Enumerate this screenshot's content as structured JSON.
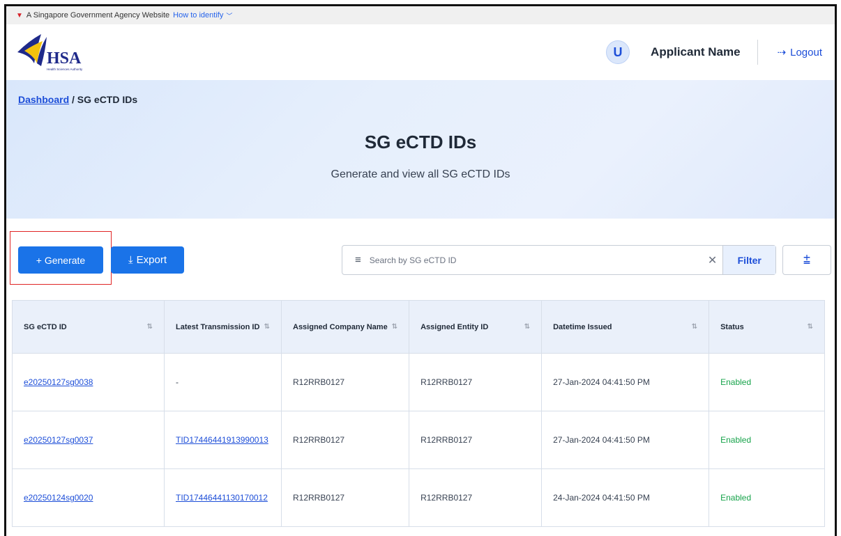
{
  "gov_banner": {
    "text": "A Singapore Government Agency Website",
    "identify_label": "How to identify"
  },
  "header": {
    "logo_text": "HSA",
    "logo_subtext": "Health Sciences Authority",
    "avatar_initial": "U",
    "applicant_name": "Applicant Name",
    "logout_label": "Logout"
  },
  "hero": {
    "breadcrumb_home": "Dashboard",
    "breadcrumb_separator": "/",
    "breadcrumb_current": "SG eCTD IDs",
    "title": "SG eCTD IDs",
    "subtitle": "Generate and view all SG eCTD IDs"
  },
  "toolbar": {
    "generate_label": "+ Generate",
    "export_label": "Export",
    "search_placeholder": "Search by SG eCTD ID",
    "filter_label": "Filter"
  },
  "table": {
    "columns": [
      "SG eCTD ID",
      "Latest Transmission ID",
      "Assigned Company Name",
      "Assigned Entity ID",
      "Datetime Issued",
      "Status"
    ],
    "rows": [
      {
        "id": "e20250127sg0038",
        "transmission": "-",
        "company": "R12RRB0127",
        "entity": "R12RRB0127",
        "datetime": "27-Jan-2024 04:41:50 PM",
        "status": "Enabled"
      },
      {
        "id": "e20250127sg0037",
        "transmission": "TID17446441913990013",
        "company": "R12RRB0127",
        "entity": "R12RRB0127",
        "datetime": "27-Jan-2024 04:41:50 PM",
        "status": "Enabled"
      },
      {
        "id": "e20250124sg0020",
        "transmission": "TID17446441130170012",
        "company": "R12RRB0127",
        "entity": "R12RRB0127",
        "datetime": "24-Jan-2024 04:41:50 PM",
        "status": "Enabled"
      }
    ]
  },
  "colors": {
    "primary": "#1a73e8",
    "link": "#1d4ed8",
    "status_enabled": "#16a34a",
    "highlight_box": "#e02424"
  },
  "icons": {
    "gov_lion": "lion-head-icon",
    "identify_chevron": "chevron-down-icon",
    "logout": "logout-icon",
    "export": "download-icon",
    "search": "filter-lines-icon",
    "clear": "close-icon",
    "sort": "sort-add-icon",
    "column_sort": "sort-arrows-icon"
  }
}
